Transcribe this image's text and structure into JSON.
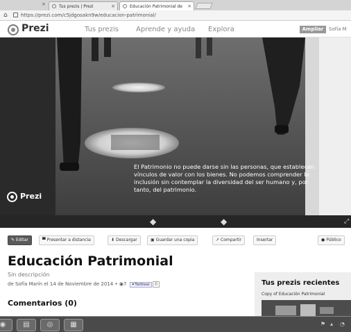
{
  "browser": {
    "tabs": [
      {
        "label": "Tus prezis | Prezi"
      },
      {
        "label": "Educación Patrimonial de"
      }
    ],
    "url": "https://prezi.com/c5jdgosakn9w/educacion-patrimonial/"
  },
  "header": {
    "logo": "Prezi",
    "nav": [
      "Tus prezis",
      "Aprende y ayuda",
      "Explora"
    ],
    "upgrade_label": "Ampliar",
    "user": "Sofía M"
  },
  "viewer": {
    "caption": "El Patrimonio no puede darse sin las personas, que establecen vínculos de valor con los bienes. No podemos comprender la inclusión sin contemplar la diversidad del ser humano y, por tanto, del patrimonio.",
    "watermark": "Prezi"
  },
  "toolbar": {
    "edit": "Editar",
    "present_remote": "Presentar a distancia",
    "download": "Descargar",
    "save_copy": "Guardar una copia",
    "share": "Compartir",
    "embed": "Insertar",
    "public": "Público"
  },
  "prezi": {
    "title": "Educación Patrimonial",
    "description": "Sin descripción",
    "meta": "de Sofía Marín el 14 de Noviembre de 2014 • ",
    "views": "7",
    "tweet_label": "Twittear",
    "tweet_count": "0"
  },
  "comments_heading": "Comentarios (0)",
  "recent": {
    "title": "Tus prezis recientes",
    "items": [
      "Copy of Educación Patrimonial"
    ]
  },
  "colors": {
    "playbar": "#262626",
    "edit_button": "#5a5a5a",
    "panel": "#eeeeee"
  }
}
